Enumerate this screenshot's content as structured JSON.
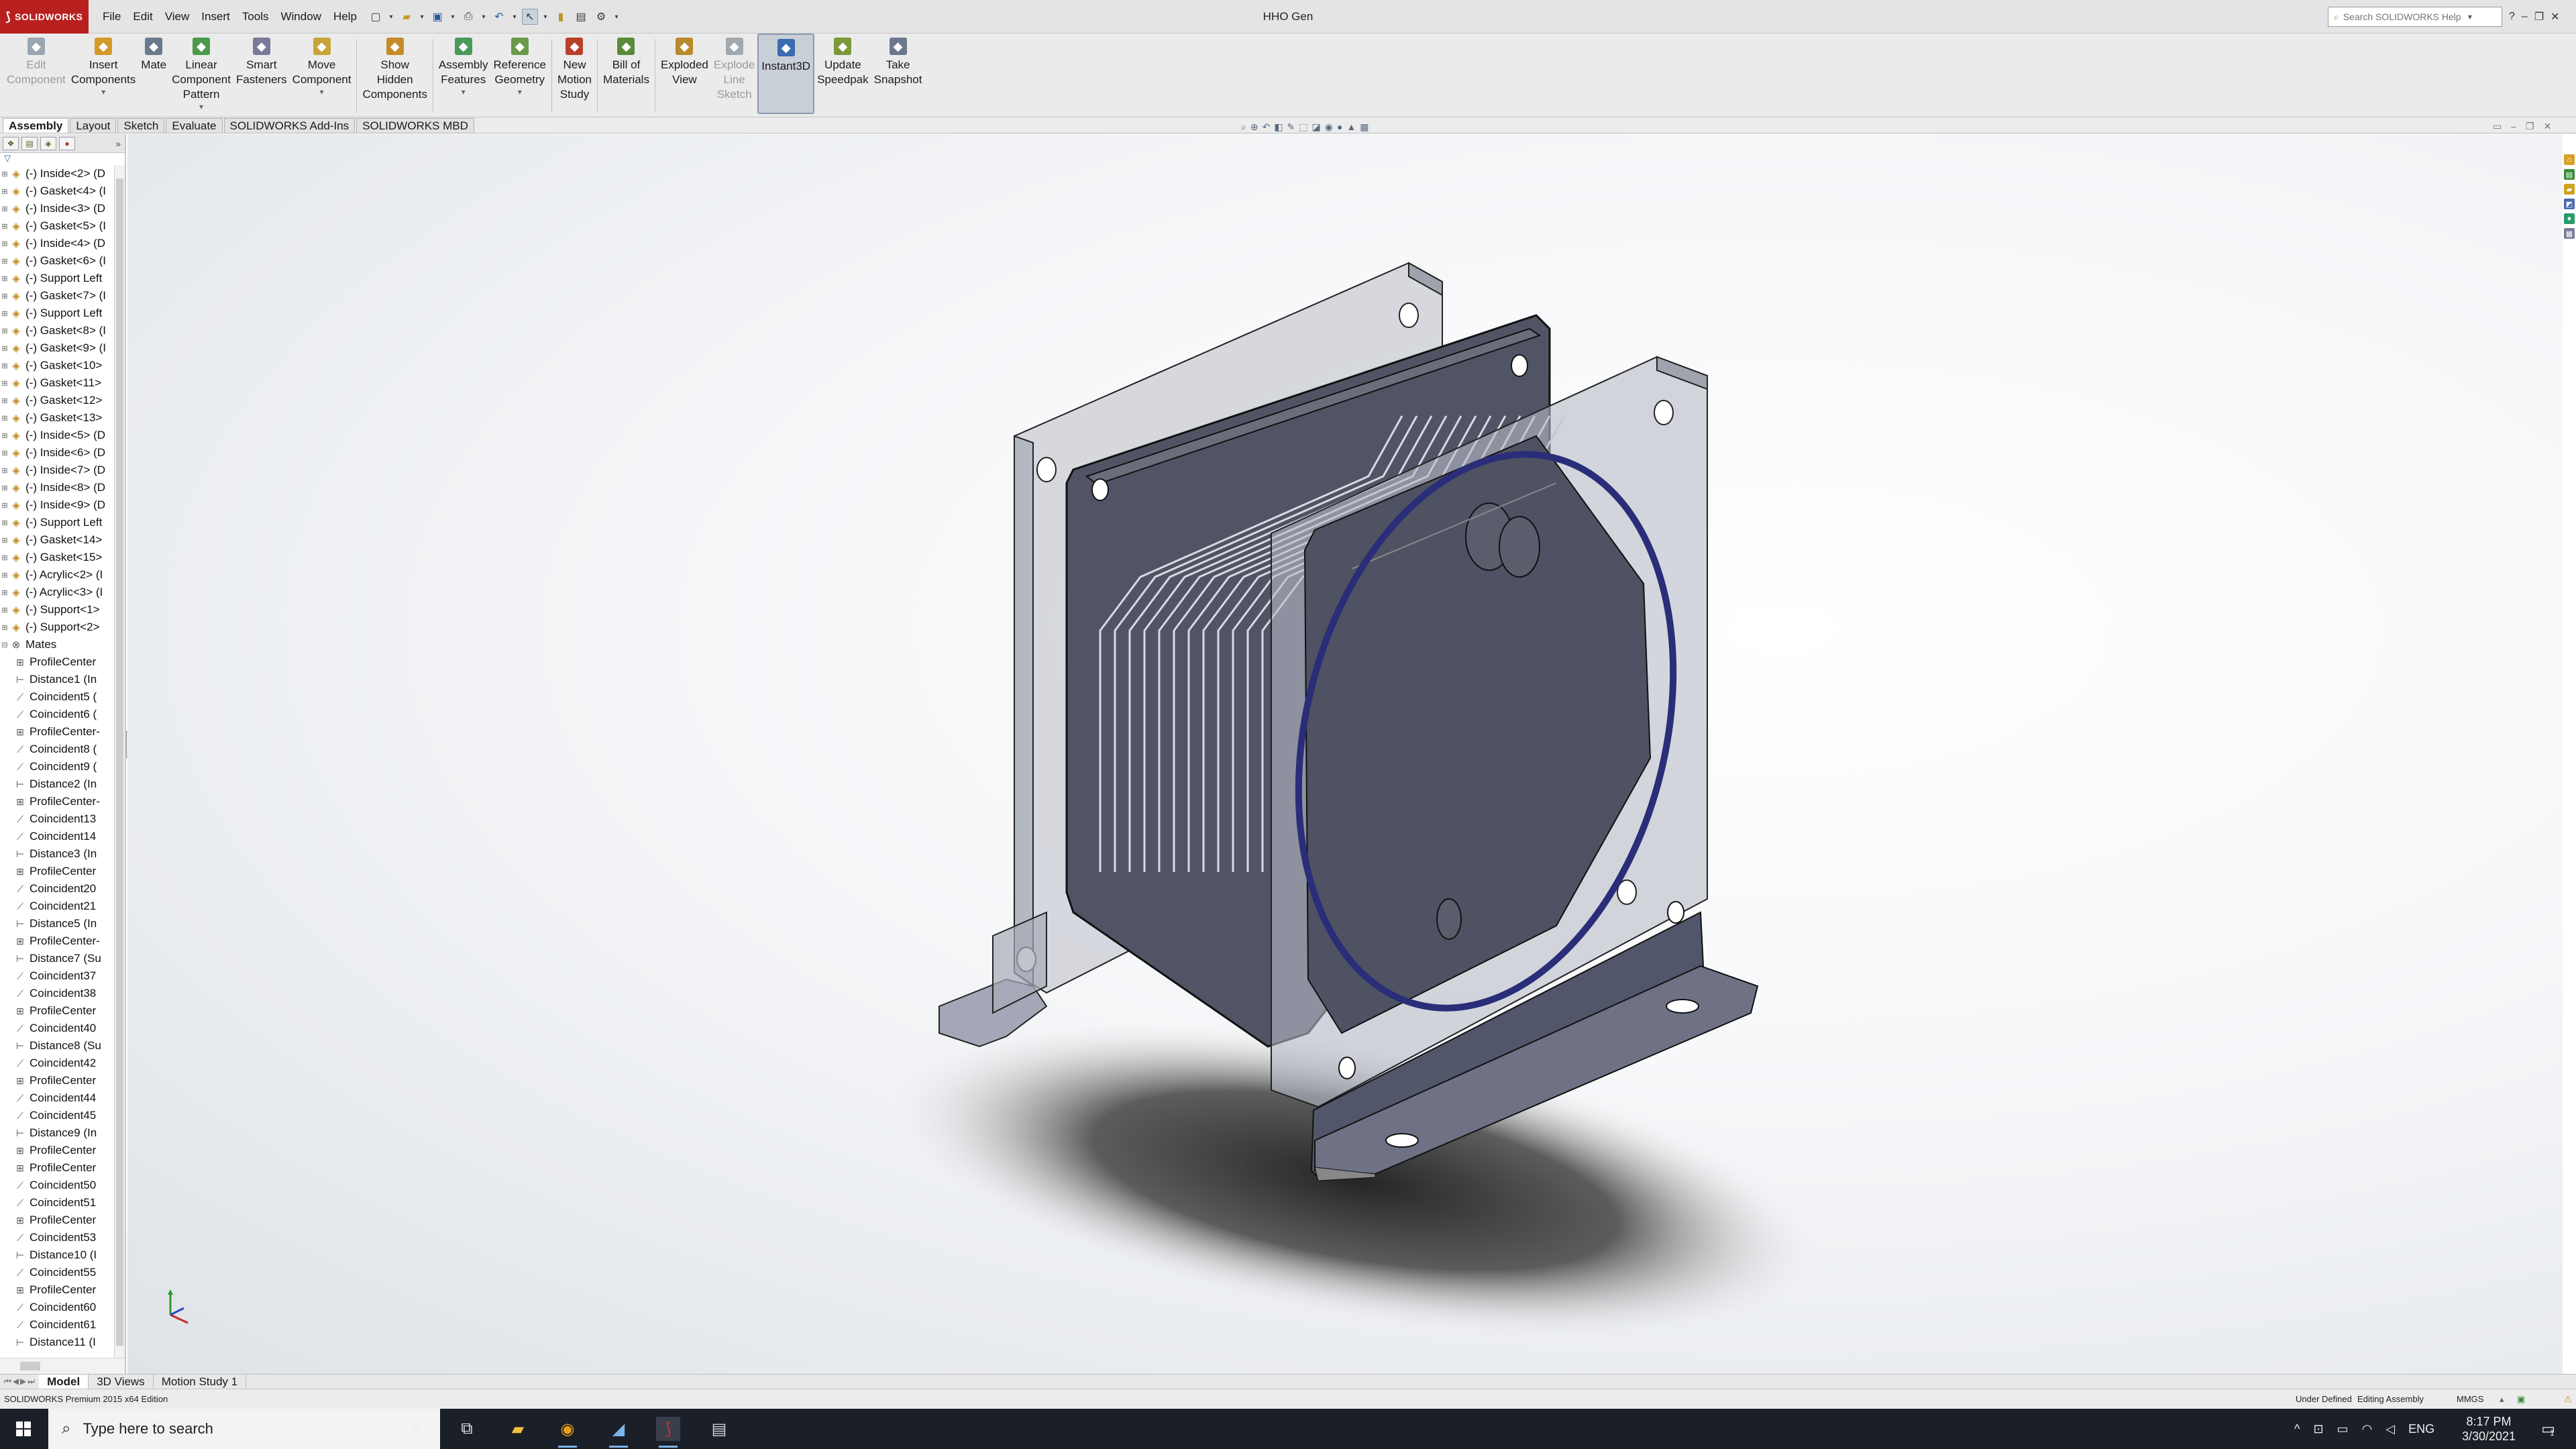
{
  "app": {
    "logo_text": "SOLIDWORKS",
    "document_title": "HHO Gen",
    "menus": [
      "File",
      "Edit",
      "View",
      "Insert",
      "Tools",
      "Window",
      "Help"
    ],
    "search_placeholder": "Search SOLIDWORKS Help"
  },
  "ribbon": {
    "commands": [
      {
        "label": "Edit\nComponent",
        "icon": "edit-component-icon",
        "color": "#9aa6b2",
        "enabled": false,
        "dropdown": false
      },
      {
        "label": "Insert\nComponents",
        "icon": "insert-components-icon",
        "color": "#d29a2a",
        "enabled": true,
        "dropdown": true
      },
      {
        "label": "Mate",
        "icon": "mate-icon",
        "color": "#6b7a8c",
        "enabled": true,
        "dropdown": false
      },
      {
        "label": "Linear\nComponent\nPattern",
        "icon": "linear-pattern-icon",
        "color": "#4c9a4c",
        "enabled": true,
        "dropdown": true
      },
      {
        "label": "Smart\nFasteners",
        "icon": "smart-fasteners-icon",
        "color": "#7a7a9a",
        "enabled": true,
        "dropdown": false
      },
      {
        "label": "Move\nComponent",
        "icon": "move-component-icon",
        "color": "#c9a43a",
        "enabled": true,
        "dropdown": true
      },
      {
        "label": "Show\nHidden\nComponents",
        "icon": "show-hidden-icon",
        "color": "#c58a2a",
        "enabled": true,
        "dropdown": false,
        "separator_before": true
      },
      {
        "label": "Assembly\nFeatures",
        "icon": "assembly-features-icon",
        "color": "#4a9a5a",
        "enabled": true,
        "dropdown": true,
        "separator_before": true
      },
      {
        "label": "Reference\nGeometry",
        "icon": "reference-geometry-icon",
        "color": "#6a9a4a",
        "enabled": true,
        "dropdown": true
      },
      {
        "label": "New\nMotion\nStudy",
        "icon": "motion-study-icon",
        "color": "#b8402a",
        "enabled": true,
        "dropdown": false,
        "separator_before": true
      },
      {
        "label": "Bill of\nMaterials",
        "icon": "bill-of-materials-icon",
        "color": "#5a8a3a",
        "enabled": true,
        "dropdown": false,
        "separator_before": true
      },
      {
        "label": "Exploded\nView",
        "icon": "exploded-view-icon",
        "color": "#b88a2a",
        "enabled": true,
        "dropdown": false,
        "separator_before": true
      },
      {
        "label": "Explode\nLine\nSketch",
        "icon": "explode-line-sketch-icon",
        "color": "#a0a8b0",
        "enabled": false,
        "dropdown": false
      },
      {
        "label": "Instant3D",
        "icon": "instant3d-icon",
        "color": "#3a6ab0",
        "enabled": true,
        "dropdown": false,
        "active": true
      },
      {
        "label": "Update\nSpeedpak",
        "icon": "update-speedpak-icon",
        "color": "#7a9a3a",
        "enabled": true,
        "dropdown": false
      },
      {
        "label": "Take\nSnapshot",
        "icon": "take-snapshot-icon",
        "color": "#6a7a8a",
        "enabled": true,
        "dropdown": false
      }
    ]
  },
  "tabs": [
    "Assembly",
    "Layout",
    "Sketch",
    "Evaluate",
    "SOLIDWORKS Add-Ins",
    "SOLIDWORKS MBD"
  ],
  "active_tab": "Assembly",
  "feature_tree": {
    "components": [
      "(-) Inside<2> (D",
      "(-) Gasket<4> (I",
      "(-) Inside<3> (D",
      "(-) Gasket<5> (I",
      "(-) Inside<4> (D",
      "(-) Gasket<6> (I",
      "(-) Support Left",
      "(-) Gasket<7> (I",
      "(-) Support Left",
      "(-) Gasket<8> (I",
      "(-) Gasket<9> (I",
      "(-) Gasket<10>",
      "(-) Gasket<11>",
      "(-) Gasket<12>",
      "(-) Gasket<13>",
      "(-) Inside<5> (D",
      "(-) Inside<6> (D",
      "(-) Inside<7> (D",
      "(-) Inside<8> (D",
      "(-) Inside<9> (D",
      "(-) Support Left",
      "(-) Gasket<14>",
      "(-) Gasket<15>",
      "(-) Acrylic<2> (I",
      "(-) Acrylic<3> (I",
      "(-) Support<1>",
      "(-) Support<2>"
    ],
    "mates_label": "Mates",
    "mates": [
      {
        "label": "ProfileCenter",
        "kind": "profile"
      },
      {
        "label": "Distance1 (In",
        "kind": "distance"
      },
      {
        "label": "Coincident5 (",
        "kind": "coincident"
      },
      {
        "label": "Coincident6 (",
        "kind": "coincident"
      },
      {
        "label": "ProfileCenter-",
        "kind": "profile"
      },
      {
        "label": "Coincident8 (",
        "kind": "coincident"
      },
      {
        "label": "Coincident9 (",
        "kind": "coincident"
      },
      {
        "label": "Distance2 (In",
        "kind": "distance"
      },
      {
        "label": "ProfileCenter-",
        "kind": "profile"
      },
      {
        "label": "Coincident13",
        "kind": "coincident"
      },
      {
        "label": "Coincident14",
        "kind": "coincident"
      },
      {
        "label": "Distance3 (In",
        "kind": "distance"
      },
      {
        "label": "ProfileCenter",
        "kind": "profile"
      },
      {
        "label": "Coincident20",
        "kind": "coincident"
      },
      {
        "label": "Coincident21",
        "kind": "coincident"
      },
      {
        "label": "Distance5 (In",
        "kind": "distance"
      },
      {
        "label": "ProfileCenter-",
        "kind": "profile"
      },
      {
        "label": "Distance7 (Su",
        "kind": "distance"
      },
      {
        "label": "Coincident37",
        "kind": "coincident"
      },
      {
        "label": "Coincident38",
        "kind": "coincident"
      },
      {
        "label": "ProfileCenter",
        "kind": "profile"
      },
      {
        "label": "Coincident40",
        "kind": "coincident"
      },
      {
        "label": "Distance8 (Su",
        "kind": "distance"
      },
      {
        "label": "Coincident42",
        "kind": "coincident"
      },
      {
        "label": "ProfileCenter",
        "kind": "profile"
      },
      {
        "label": "Coincident44",
        "kind": "coincident"
      },
      {
        "label": "Coincident45",
        "kind": "coincident"
      },
      {
        "label": "Distance9 (In",
        "kind": "distance"
      },
      {
        "label": "ProfileCenter",
        "kind": "profile"
      },
      {
        "label": "ProfileCenter",
        "kind": "profile"
      },
      {
        "label": "Coincident50",
        "kind": "coincident"
      },
      {
        "label": "Coincident51",
        "kind": "coincident"
      },
      {
        "label": "ProfileCenter",
        "kind": "profile"
      },
      {
        "label": "Coincident53",
        "kind": "coincident"
      },
      {
        "label": "Distance10 (I",
        "kind": "distance"
      },
      {
        "label": "Coincident55",
        "kind": "coincident"
      },
      {
        "label": "ProfileCenter",
        "kind": "profile"
      },
      {
        "label": "Coincident60",
        "kind": "coincident"
      },
      {
        "label": "Coincident61",
        "kind": "coincident"
      },
      {
        "label": "Distance11 (I",
        "kind": "distance"
      }
    ]
  },
  "bottom_tabs": [
    "Model",
    "3D Views",
    "Motion Study 1"
  ],
  "active_bottom_tab": "Model",
  "status": {
    "edition": "SOLIDWORKS Premium 2015 x64 Edition",
    "definition": "Under Defined",
    "mode": "Editing Assembly",
    "units": "MMGS"
  },
  "taskbar": {
    "search_placeholder": "Type here to search",
    "language": "ENG",
    "time": "8:17 PM",
    "date": "3/30/2021",
    "notification_count": "1"
  }
}
